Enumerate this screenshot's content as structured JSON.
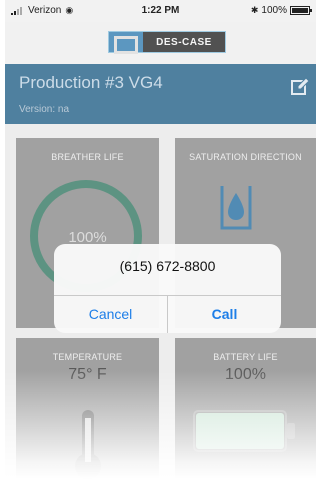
{
  "status_bar": {
    "carrier": "Verizon",
    "time": "1:22 PM",
    "battery_percent": "100%",
    "icons": [
      "signal-icon",
      "wifi-icon",
      "bluetooth-icon",
      "battery-icon"
    ]
  },
  "logo": {
    "text": "DES-CASE"
  },
  "header": {
    "title": "Production #3 VG4",
    "version": "Version: na",
    "edit_icon": "edit-icon"
  },
  "tiles": {
    "breather_life": {
      "label": "BREATHER LIFE",
      "value": "100%",
      "level": 1.0
    },
    "saturation_direction": {
      "label": "SATURATION DIRECTION",
      "icon": "water-drop-icon"
    },
    "temperature": {
      "label": "TEMPERATURE",
      "value": "75° F",
      "icon": "thermometer-icon"
    },
    "battery_life": {
      "label": "BATTERY LIFE",
      "value": "100%",
      "level": 1.0,
      "icon": "battery-icon"
    }
  },
  "alert": {
    "message": "(615) 672-8800",
    "cancel_label": "Cancel",
    "call_label": "Call"
  },
  "colors": {
    "header_bg": "#0c4f7a",
    "tile_bg": "#7d7d7d",
    "ring_green": "#1f6a52",
    "drop_blue": "#0f5f98",
    "battery_green": "#b9dcc6",
    "ios_blue": "#1d7ee8"
  }
}
